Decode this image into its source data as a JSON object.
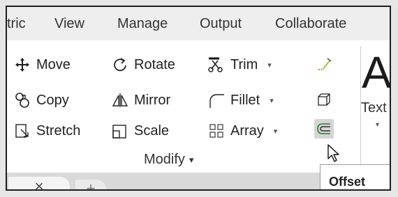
{
  "ribbon_tabs": [
    "tric",
    "View",
    "Manage",
    "Output",
    "Collaborate"
  ],
  "tools": {
    "move": "Move",
    "copy": "Copy",
    "stretch": "Stretch",
    "rotate": "Rotate",
    "mirror": "Mirror",
    "scale": "Scale",
    "trim": "Trim",
    "fillet": "Fillet",
    "array": "Array"
  },
  "dropdown_caret": "▾",
  "panel_label": "Modify",
  "panel_caret": "▾",
  "text_tool": {
    "big_glyph": "A",
    "label": "Text",
    "caret": "▾"
  },
  "tooltip": "Offset",
  "doc_tabs": {
    "close": "×",
    "plus": "+"
  }
}
